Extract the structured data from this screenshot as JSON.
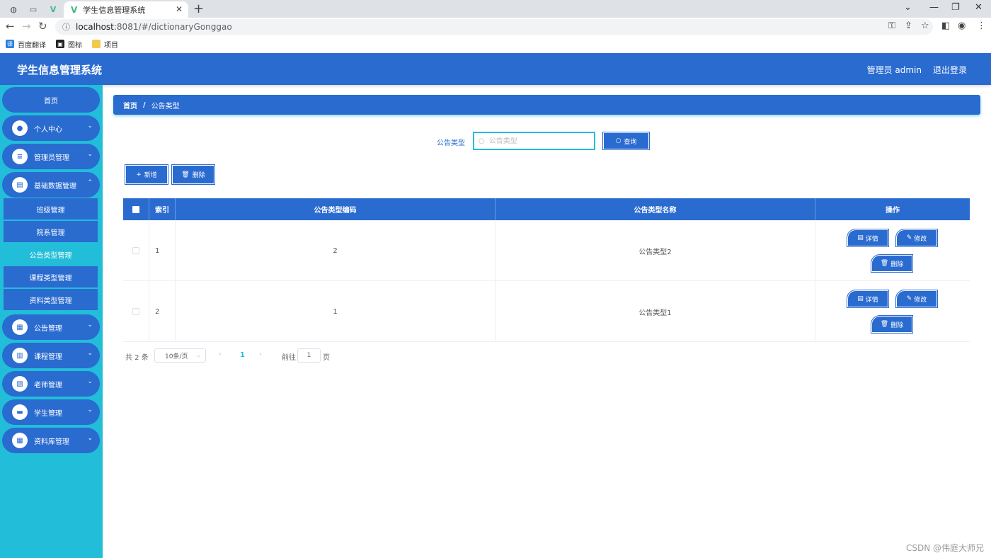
{
  "browser": {
    "tab_title": "学生信息管理系统",
    "url_host": "localhost",
    "url_path": ":8081/#/dictionaryGonggao",
    "bookmarks": [
      {
        "label": "百度翻译",
        "color": "#2b7fe0"
      },
      {
        "label": "图标",
        "color": "#222222"
      },
      {
        "label": "项目",
        "color": "#f2c94c"
      }
    ]
  },
  "header": {
    "title": "学生信息管理系统",
    "user": "管理员 admin",
    "logout": "退出登录"
  },
  "sidebar": {
    "home": "首页",
    "menus": [
      {
        "label": "个人中心",
        "icon": "user-icon"
      },
      {
        "label": "管理员管理",
        "icon": "list-icon"
      },
      {
        "label": "基础数据管理",
        "icon": "clipboard-icon"
      },
      {
        "label": "公告管理",
        "icon": "grid-icon"
      },
      {
        "label": "课程管理",
        "icon": "bar-chart-icon"
      },
      {
        "label": "老师管理",
        "icon": "document-icon"
      },
      {
        "label": "学生管理",
        "icon": "monitor-icon"
      },
      {
        "label": "资料库管理",
        "icon": "grid-icon"
      }
    ],
    "submenu": [
      "班级管理",
      "院系管理",
      "公告类型管理",
      "课程类型管理",
      "资料类型管理"
    ],
    "active_sub": "公告类型管理"
  },
  "breadcrumb": {
    "home": "首页",
    "separator": "/",
    "current": "公告类型"
  },
  "search": {
    "label": "公告类型",
    "placeholder": "公告类型",
    "button": "查询"
  },
  "toolbar": {
    "add": "新增",
    "delete": "删除"
  },
  "table": {
    "columns": [
      "索引",
      "公告类型编码",
      "公告类型名称",
      "操作"
    ],
    "rows": [
      {
        "index": "1",
        "code": "2",
        "name": "公告类型2"
      },
      {
        "index": "2",
        "code": "1",
        "name": "公告类型1"
      }
    ],
    "actions": {
      "detail": "详情",
      "edit": "修改",
      "delete": "删除"
    }
  },
  "pagination": {
    "total": "共 2 条",
    "page_size": "10条/页",
    "current_page": "1",
    "goto_label": "前往",
    "goto_value": "1",
    "page_suffix": "页"
  },
  "watermark": "CSDN @伟庭大师兄",
  "colors": {
    "primary": "#2a6bd0",
    "accent": "#22bdd9"
  }
}
